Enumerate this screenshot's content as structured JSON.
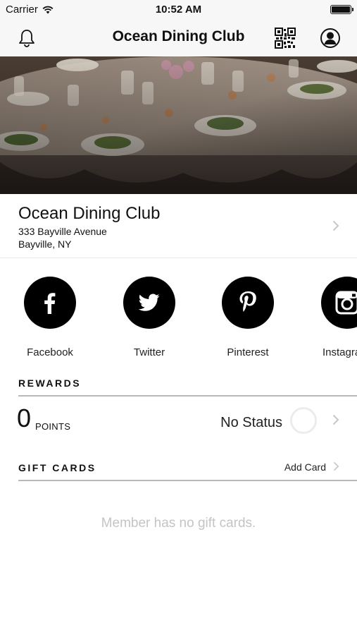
{
  "status_bar": {
    "carrier": "Carrier",
    "time": "10:52 AM",
    "battery_level": 1.0
  },
  "nav": {
    "title": "Ocean Dining Club",
    "left_icon": "bell-icon",
    "right_icons": [
      "qr-code-icon",
      "profile-icon"
    ]
  },
  "hero": {
    "icon": "banquet-table-photo"
  },
  "venue": {
    "name": "Ocean Dining Club",
    "address_line1": "333 Bayville Avenue",
    "address_line2": "Bayville, NY"
  },
  "social": [
    {
      "label": "Facebook",
      "icon": "facebook-icon"
    },
    {
      "label": "Twitter",
      "icon": "twitter-icon"
    },
    {
      "label": "Pinterest",
      "icon": "pinterest-icon"
    },
    {
      "label": "Instagram",
      "icon": "instagram-icon"
    }
  ],
  "rewards": {
    "section_title": "REWARDS",
    "points_value": "0",
    "points_label": "POINTS",
    "status": "No Status"
  },
  "gift_cards": {
    "section_title": "GIFT CARDS",
    "add_card_label": "Add Card",
    "empty_message": "Member has no gift cards."
  },
  "colors": {
    "bar_background": "#f7f7f7",
    "social_circle": "#000000",
    "divider": "#b8b8b8",
    "empty_text": "#c4c4c4"
  }
}
